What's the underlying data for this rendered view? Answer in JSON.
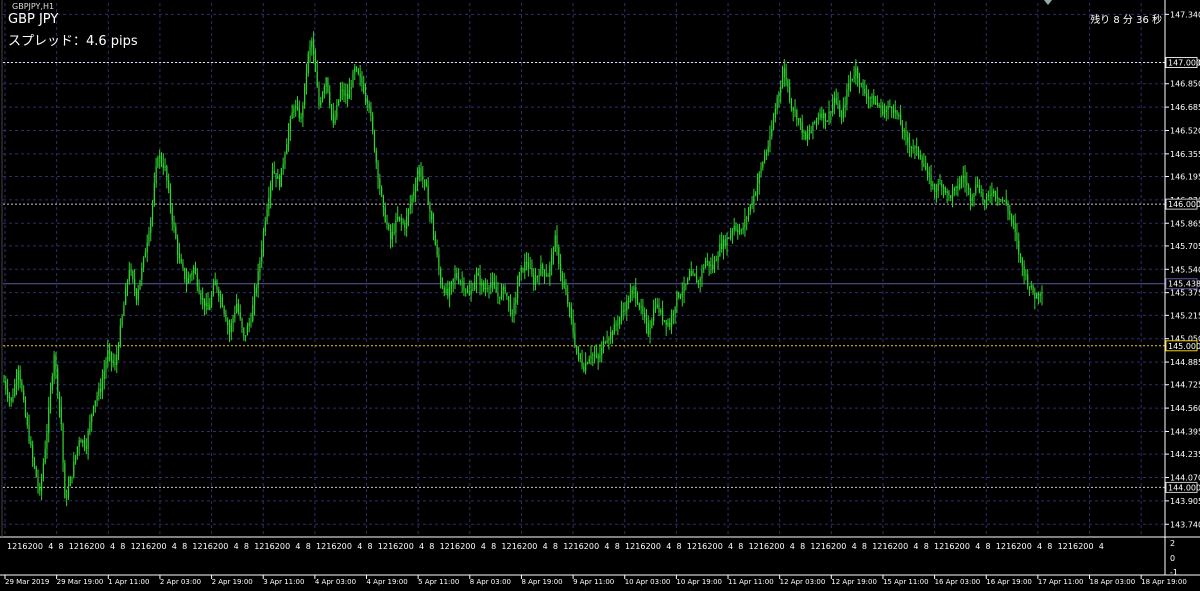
{
  "window": {
    "tiny_title": "GBPJPY,H1",
    "symbol_label": "GBP JPY",
    "spread_label": "スプレッド：4.6 pips",
    "timer_label": "残り 8 分 36 秒"
  },
  "colors": {
    "background": "#000000",
    "grid": "#2e2e6e",
    "candle": "#2fd62f",
    "level_line": "#c8c8c8",
    "yellow_line": "#f2d000",
    "bid_line": "#5a5aa0"
  },
  "chart_data": {
    "type": "candlestick",
    "symbol": "GBPJPY",
    "timeframe": "H1",
    "ylim": [
      143.65,
      147.42
    ],
    "yticks": [
      "147.340",
      "147.000",
      "146.850",
      "146.685",
      "146.520",
      "146.355",
      "146.195",
      "146.030",
      "145.865",
      "145.705",
      "145.540",
      "145.375",
      "145.215",
      "145.050",
      "144.885",
      "144.725",
      "144.560",
      "144.395",
      "144.235",
      "144.070",
      "143.905",
      "143.740"
    ],
    "horizontal_lines": [
      {
        "label": "147.000",
        "value": 147.0,
        "style": "dashed",
        "color": "#e0e0e0"
      },
      {
        "label": "146.000",
        "value": 146.0,
        "style": "dashed",
        "color": "#c8c8c8"
      },
      {
        "label": "145.438",
        "value": 145.438,
        "style": "solid",
        "color": "#5a5aa0"
      },
      {
        "label": "145.000",
        "value": 145.0,
        "style": "dashed",
        "color": "#f2d000"
      },
      {
        "label": "144.000",
        "value": 144.0,
        "style": "dashed",
        "color": "#c8c8c8"
      }
    ],
    "hour_ticks": [
      "12",
      "16",
      "20",
      "0",
      "4",
      "8",
      "12",
      "16",
      "20",
      "0",
      "4",
      "8",
      "12",
      "16",
      "20",
      "0",
      "4",
      "8",
      "12",
      "16",
      "20",
      "0",
      "4",
      "8",
      "12",
      "16",
      "20",
      "0",
      "4",
      "8",
      "12",
      "16",
      "20",
      "0",
      "4",
      "8",
      "12",
      "16",
      "20",
      "0",
      "4",
      "8",
      "12",
      "16",
      "20",
      "0",
      "4",
      "8",
      "12",
      "16",
      "20",
      "0",
      "4",
      "8",
      "12",
      "16",
      "20",
      "0",
      "4",
      "8",
      "12",
      "16",
      "20",
      "0",
      "4",
      "8",
      "12",
      "16",
      "20",
      "0",
      "4",
      "8",
      "12",
      "16",
      "20",
      "0",
      "4",
      "8",
      "12",
      "16",
      "20",
      "0",
      "4",
      "8",
      "12",
      "16",
      "20",
      "0",
      "4",
      "8",
      "12",
      "16",
      "20",
      "0",
      "4",
      "8",
      "12",
      "16",
      "20",
      "0",
      "4",
      "8",
      "12",
      "16",
      "20",
      "0",
      "4"
    ],
    "date_ticks": [
      "29 Mar 2019",
      "29 Mar 19:00",
      "1 Apr 11:00",
      "2 Apr 03:00",
      "2 Apr 19:00",
      "3 Apr 11:00",
      "4 Apr 03:00",
      "4 Apr 19:00",
      "5 Apr 11:00",
      "8 Apr 03:00",
      "8 Apr 19:00",
      "9 Apr 11:00",
      "10 Apr 03:00",
      "10 Apr 19:00",
      "11 Apr 11:00",
      "12 Apr 03:00",
      "12 Apr 19:00",
      "15 Apr 11:00",
      "16 Apr 03:00",
      "16 Apr 19:00",
      "17 Apr 11:00",
      "18 Apr 03:00",
      "18 Apr 19:00"
    ],
    "bottom_axis_labels": [
      "2",
      "0",
      "-1"
    ],
    "close_path": [
      [
        0,
        144.75
      ],
      [
        4,
        144.6
      ],
      [
        8,
        144.85
      ],
      [
        12,
        144.5
      ],
      [
        16,
        144.2
      ],
      [
        20,
        143.95
      ],
      [
        24,
        144.4
      ],
      [
        28,
        144.95
      ],
      [
        32,
        144.45
      ],
      [
        34,
        143.9
      ],
      [
        38,
        144.1
      ],
      [
        42,
        144.35
      ],
      [
        46,
        144.3
      ],
      [
        50,
        144.6
      ],
      [
        54,
        144.7
      ],
      [
        58,
        144.95
      ],
      [
        62,
        144.85
      ],
      [
        66,
        145.2
      ],
      [
        70,
        145.55
      ],
      [
        74,
        145.35
      ],
      [
        78,
        145.6
      ],
      [
        82,
        145.9
      ],
      [
        86,
        146.35
      ],
      [
        90,
        146.25
      ],
      [
        94,
        145.9
      ],
      [
        98,
        145.6
      ],
      [
        102,
        145.45
      ],
      [
        106,
        145.55
      ],
      [
        110,
        145.35
      ],
      [
        114,
        145.25
      ],
      [
        118,
        145.45
      ],
      [
        122,
        145.3
      ],
      [
        126,
        145.1
      ],
      [
        130,
        145.3
      ],
      [
        134,
        145.05
      ],
      [
        138,
        145.2
      ],
      [
        142,
        145.5
      ],
      [
        146,
        145.9
      ],
      [
        150,
        146.25
      ],
      [
        154,
        146.15
      ],
      [
        158,
        146.45
      ],
      [
        162,
        146.7
      ],
      [
        166,
        146.6
      ],
      [
        170,
        147.05
      ],
      [
        172,
        147.15
      ],
      [
        176,
        146.7
      ],
      [
        180,
        146.9
      ],
      [
        184,
        146.55
      ],
      [
        188,
        146.8
      ],
      [
        192,
        146.75
      ],
      [
        196,
        146.95
      ],
      [
        200,
        146.85
      ],
      [
        204,
        146.7
      ],
      [
        208,
        146.3
      ],
      [
        212,
        145.95
      ],
      [
        216,
        145.75
      ],
      [
        220,
        145.9
      ],
      [
        224,
        145.85
      ],
      [
        228,
        146.05
      ],
      [
        232,
        146.25
      ],
      [
        236,
        146.1
      ],
      [
        240,
        145.8
      ],
      [
        244,
        145.45
      ],
      [
        248,
        145.35
      ],
      [
        252,
        145.5
      ],
      [
        256,
        145.45
      ],
      [
        260,
        145.35
      ],
      [
        264,
        145.5
      ],
      [
        268,
        145.4
      ],
      [
        272,
        145.45
      ],
      [
        276,
        145.35
      ],
      [
        280,
        145.4
      ],
      [
        284,
        145.2
      ],
      [
        288,
        145.5
      ],
      [
        292,
        145.6
      ],
      [
        296,
        145.45
      ],
      [
        300,
        145.55
      ],
      [
        304,
        145.5
      ],
      [
        308,
        145.75
      ],
      [
        312,
        145.45
      ],
      [
        316,
        145.25
      ],
      [
        320,
        144.95
      ],
      [
        324,
        144.85
      ],
      [
        328,
        144.95
      ],
      [
        332,
        144.9
      ],
      [
        336,
        145.05
      ],
      [
        340,
        145.1
      ],
      [
        344,
        145.2
      ],
      [
        348,
        145.3
      ],
      [
        352,
        145.4
      ],
      [
        356,
        145.25
      ],
      [
        360,
        145.1
      ],
      [
        364,
        145.3
      ],
      [
        368,
        145.2
      ],
      [
        372,
        145.15
      ],
      [
        376,
        145.35
      ],
      [
        380,
        145.4
      ],
      [
        384,
        145.5
      ],
      [
        388,
        145.45
      ],
      [
        392,
        145.6
      ],
      [
        396,
        145.55
      ],
      [
        400,
        145.7
      ],
      [
        404,
        145.75
      ],
      [
        408,
        145.85
      ],
      [
        412,
        145.8
      ],
      [
        416,
        145.95
      ],
      [
        420,
        146.1
      ],
      [
        424,
        146.3
      ],
      [
        428,
        146.45
      ],
      [
        432,
        146.75
      ],
      [
        436,
        146.95
      ],
      [
        440,
        146.7
      ],
      [
        444,
        146.6
      ],
      [
        448,
        146.45
      ],
      [
        452,
        146.55
      ],
      [
        456,
        146.65
      ],
      [
        460,
        146.6
      ],
      [
        464,
        146.75
      ],
      [
        468,
        146.6
      ],
      [
        472,
        146.85
      ],
      [
        476,
        146.95
      ],
      [
        480,
        146.8
      ],
      [
        484,
        146.75
      ],
      [
        488,
        146.7
      ],
      [
        492,
        146.65
      ],
      [
        496,
        146.7
      ],
      [
        500,
        146.6
      ],
      [
        504,
        146.45
      ],
      [
        508,
        146.4
      ],
      [
        512,
        146.35
      ],
      [
        516,
        146.2
      ],
      [
        520,
        146.1
      ],
      [
        524,
        146.15
      ],
      [
        528,
        146.05
      ],
      [
        532,
        146.1
      ],
      [
        536,
        146.2
      ],
      [
        540,
        146.05
      ],
      [
        544,
        146.15
      ],
      [
        548,
        146.0
      ],
      [
        552,
        146.1
      ],
      [
        556,
        146.05
      ],
      [
        560,
        146.0
      ],
      [
        564,
        145.85
      ],
      [
        568,
        145.6
      ],
      [
        572,
        145.45
      ],
      [
        576,
        145.35
      ],
      [
        580,
        145.4
      ]
    ]
  }
}
